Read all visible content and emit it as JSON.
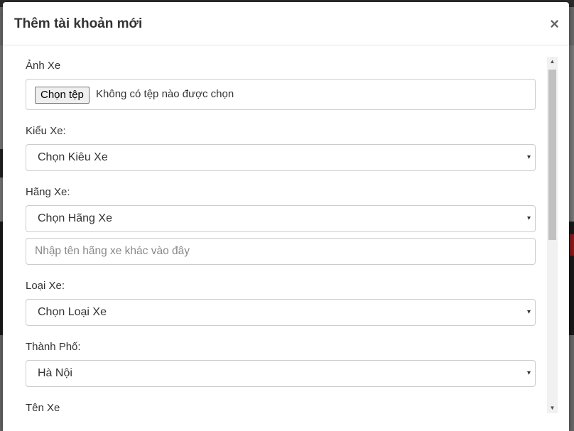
{
  "modal": {
    "title": "Thêm tài khoản mới",
    "close_label": "×"
  },
  "form": {
    "image": {
      "label": "Ảnh Xe",
      "button_label": "Chọn tệp",
      "status": "Không có tệp nào được chọn"
    },
    "car_style": {
      "label": "Kiểu Xe:",
      "selected": "Chọn Kiêu Xe"
    },
    "car_brand": {
      "label": "Hãng Xe:",
      "selected": "Chọn Hãng Xe",
      "other_placeholder": "Nhập tên hãng xe khác vào đây"
    },
    "car_type": {
      "label": "Loại Xe:",
      "selected": "Chọn Loại Xe"
    },
    "city": {
      "label": "Thành Phố:",
      "selected": "Hà Nội"
    },
    "car_name": {
      "label": "Tên Xe"
    }
  },
  "icons": {
    "caret": "▾",
    "scroll_up": "▲",
    "scroll_down": "▼"
  }
}
